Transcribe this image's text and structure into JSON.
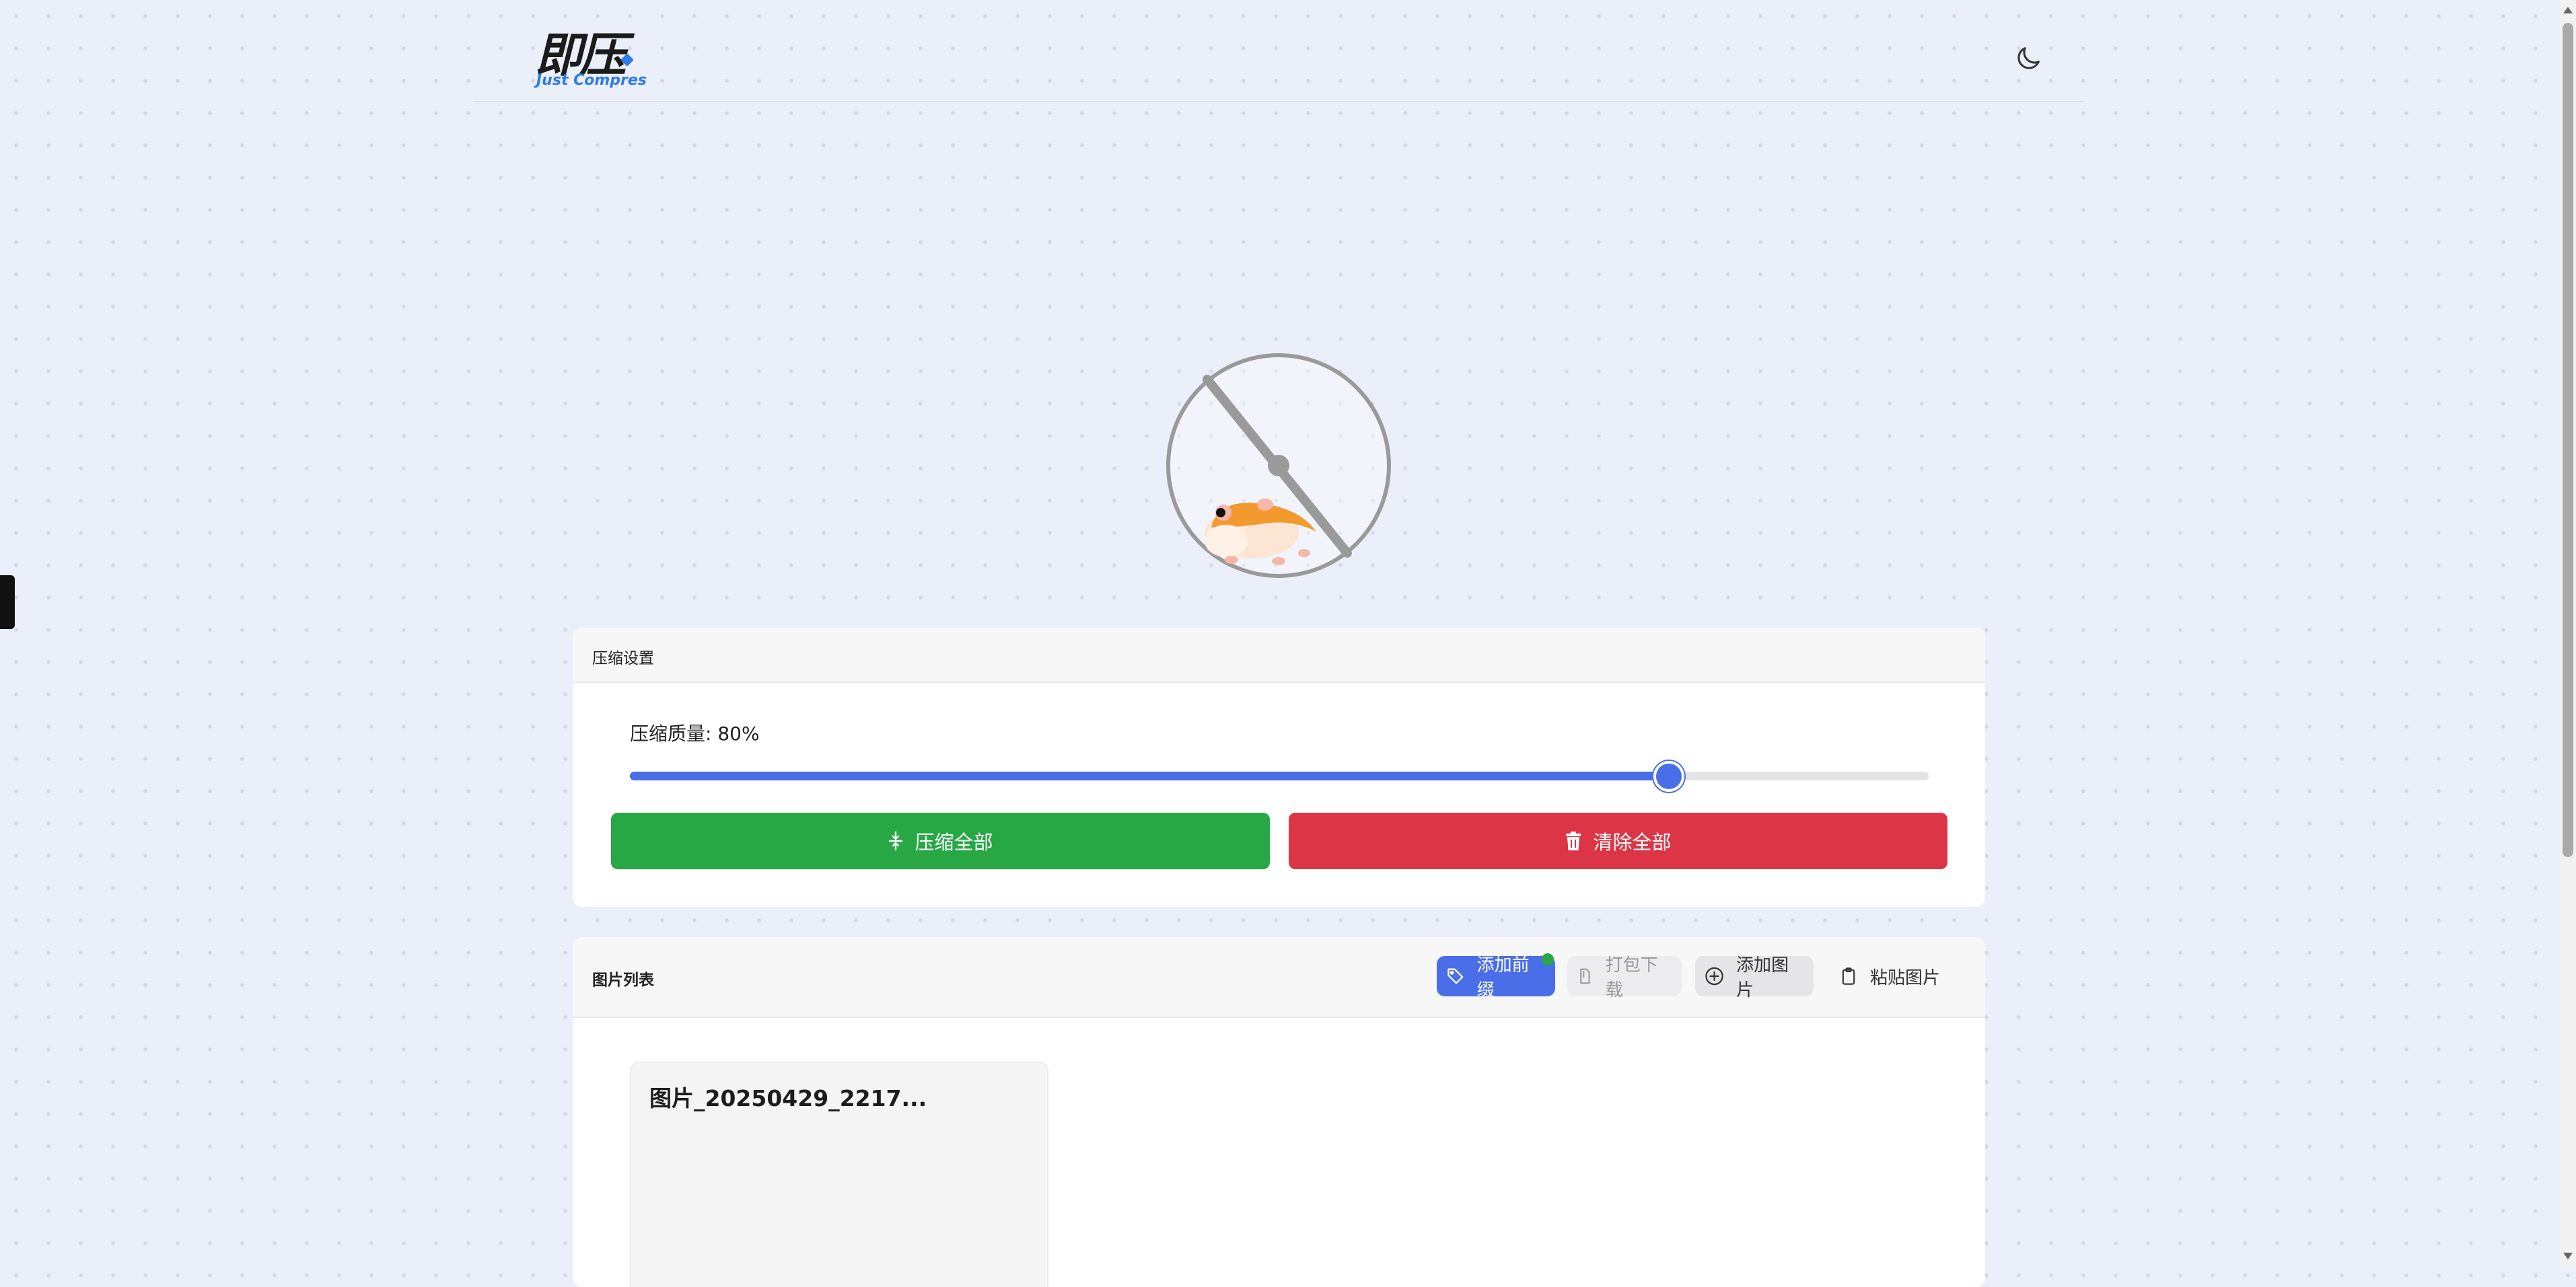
{
  "header": {
    "logo_main": "即压",
    "logo_sub": "Just Compres",
    "theme_icon": "moon-icon"
  },
  "hero": {
    "illustration": "hamster-wheel"
  },
  "settings": {
    "title": "压缩设置",
    "quality_label": "压缩质量: 80%",
    "quality_value": 80,
    "compress_all_label": "压缩全部",
    "clear_all_label": "清除全部"
  },
  "images": {
    "title": "图片列表",
    "add_prefix_label": "添加前缀",
    "zip_download_label": "打包下载",
    "add_image_label": "添加图片",
    "paste_image_label": "粘贴图片",
    "files": [
      {
        "name": "图片_20250429_2217..."
      }
    ]
  },
  "colors": {
    "accent": "#4a6ee8",
    "success": "#28a745",
    "danger": "#dc3545",
    "logo_blue": "#2f7be6"
  }
}
